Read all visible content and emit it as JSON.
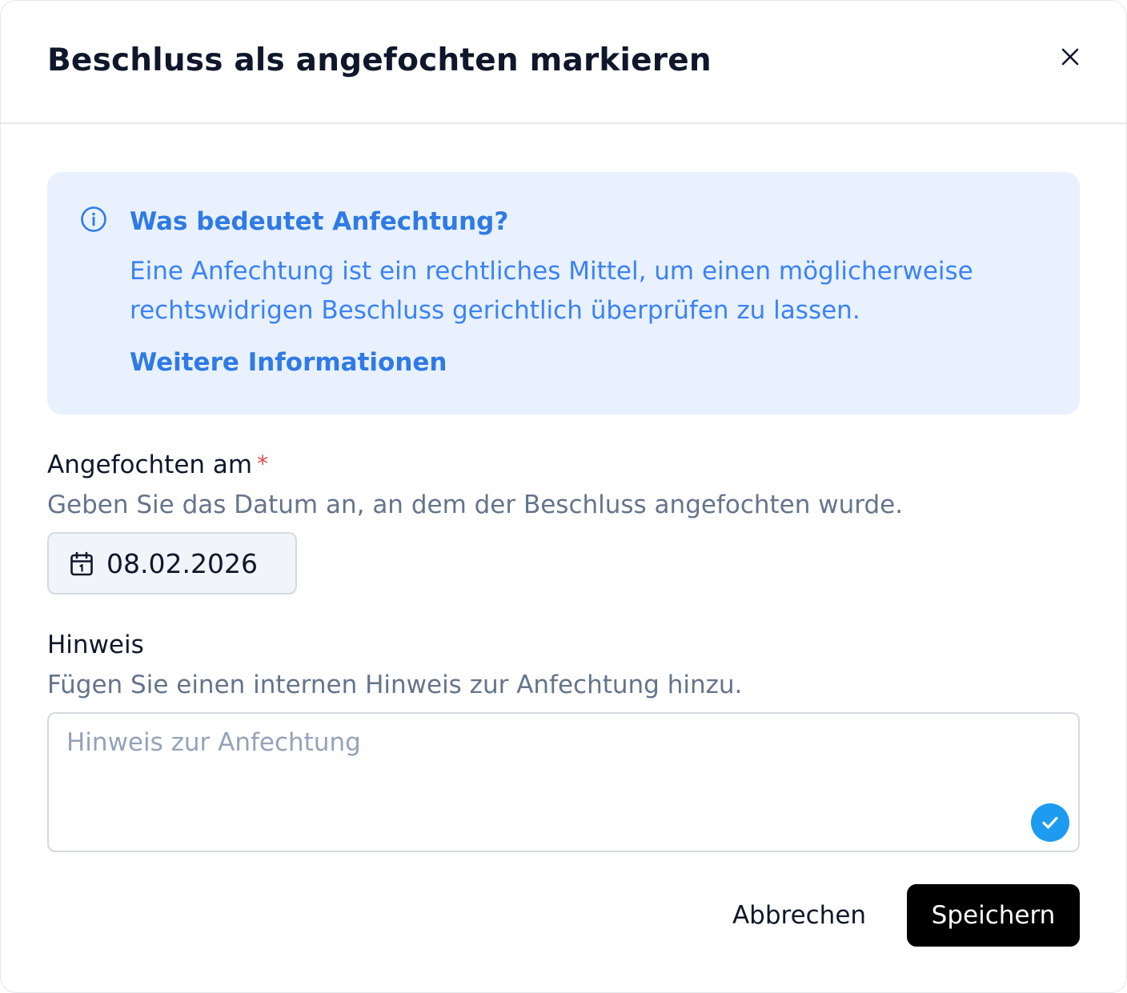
{
  "dialog": {
    "title": "Beschluss als angefochten markieren",
    "close_icon": "close-icon"
  },
  "info": {
    "icon": "info-icon",
    "title": "Was bedeutet Anfechtung?",
    "text": "Eine Anfechtung ist ein rechtliches Mittel, um einen möglicherweise rechtswidrigen Beschluss gerichtlich überprüfen zu lassen.",
    "link": "Weitere Informationen",
    "accent_color": "#2f7ae5",
    "background_color": "#e8f1fd"
  },
  "date_field": {
    "label": "Angefochten am",
    "required_marker": "*",
    "description": "Geben Sie das Datum an, an dem der Beschluss angefochten wurde.",
    "icon": "calendar-icon",
    "value": "08.02.2026"
  },
  "note_field": {
    "label": "Hinweis",
    "description": "Fügen Sie einen internen Hinweis zur Anfechtung hinzu.",
    "placeholder": "Hinweis zur Anfechtung",
    "value": "",
    "status_icon": "check-circle-icon",
    "status_color": "#1d9bf0"
  },
  "actions": {
    "cancel_label": "Abbrechen",
    "save_label": "Speichern",
    "primary_color": "#000000"
  }
}
